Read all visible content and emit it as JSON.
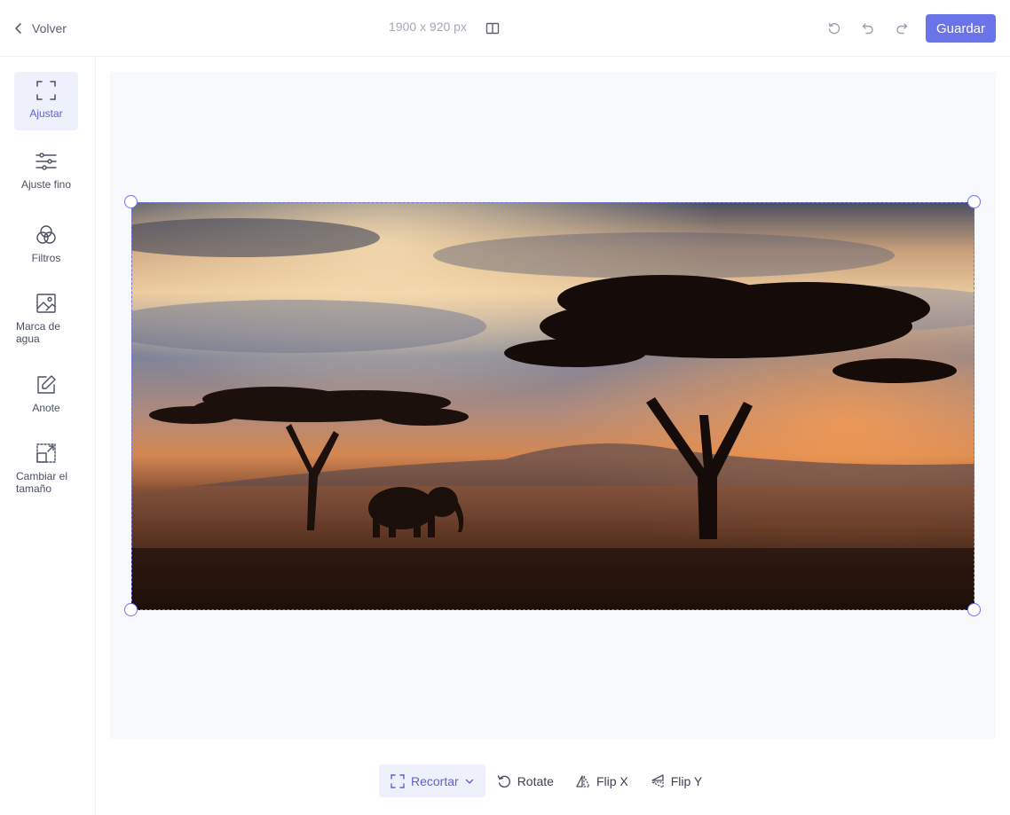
{
  "header": {
    "back_label": "Volver",
    "dimensions": "1900 x 920 px",
    "save_label": "Guardar"
  },
  "sidebar": {
    "items": [
      {
        "label": "Ajustar",
        "icon": "fit-icon",
        "active": true
      },
      {
        "label": "Ajuste fino",
        "icon": "sliders-icon"
      },
      {
        "label": "Filtros",
        "icon": "filters-icon"
      },
      {
        "label": "Marca de agua",
        "icon": "watermark-icon"
      },
      {
        "label": "Anote",
        "icon": "annotate-icon"
      },
      {
        "label": "Cambiar el tamaño",
        "icon": "resize-icon"
      }
    ]
  },
  "toolbar": {
    "crop_label": "Recortar",
    "rotate_label": "Rotate",
    "flipx_label": "Flip X",
    "flipy_label": "Flip Y"
  },
  "colors": {
    "accent": "#6a73e8",
    "active_bg": "#eef1fb",
    "canvas_bg": "#f8f9fc"
  }
}
